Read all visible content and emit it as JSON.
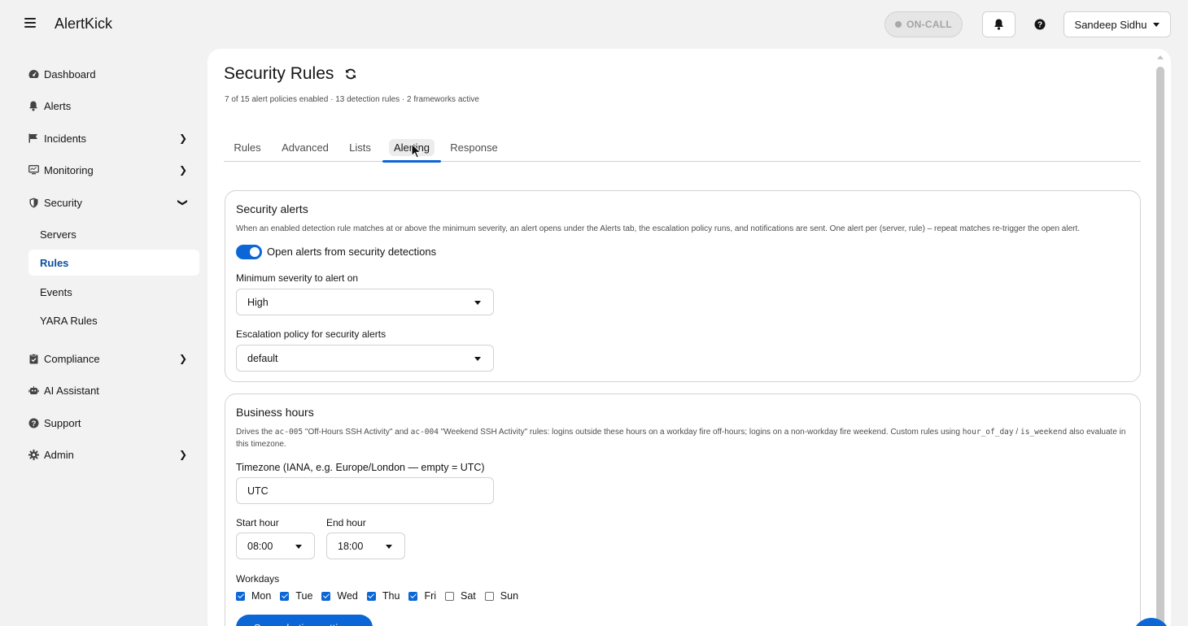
{
  "app": {
    "name": "AlertKick"
  },
  "header": {
    "oncall_label": "ON-CALL",
    "user_name": "Sandeep Sidhu"
  },
  "sidebar": {
    "items": [
      {
        "label": "Dashboard",
        "icon": "dashboard-icon"
      },
      {
        "label": "Alerts",
        "icon": "bell-icon"
      },
      {
        "label": "Incidents",
        "icon": "flag-icon"
      },
      {
        "label": "Monitoring",
        "icon": "monitor-icon"
      },
      {
        "label": "Security",
        "icon": "shield-icon"
      },
      {
        "label": "Compliance",
        "icon": "clipboard-icon"
      },
      {
        "label": "AI Assistant",
        "icon": "robot-icon"
      },
      {
        "label": "Support",
        "icon": "help-icon"
      },
      {
        "label": "Admin",
        "icon": "gear-icon"
      }
    ],
    "security_children": [
      {
        "label": "Servers"
      },
      {
        "label": "Rules"
      },
      {
        "label": "Events"
      },
      {
        "label": "YARA Rules"
      }
    ],
    "active": "Rules"
  },
  "page": {
    "title": "Security Rules",
    "subtitle": "7 of 15 alert policies enabled · 13 detection rules · 2 frameworks active"
  },
  "tabs": [
    {
      "label": "Rules"
    },
    {
      "label": "Advanced"
    },
    {
      "label": "Lists"
    },
    {
      "label": "Alerting"
    },
    {
      "label": "Response"
    }
  ],
  "active_tab": "Alerting",
  "security_alerts": {
    "title": "Security alerts",
    "description": "When an enabled detection rule matches at or above the minimum severity, an alert opens under the Alerts tab, the escalation policy runs, and notifications are sent. One alert per (server, rule) – repeat matches re-trigger the open alert.",
    "toggle_label": "Open alerts from security detections",
    "toggle_on": true,
    "severity_label": "Minimum severity to alert on",
    "severity_value": "High",
    "escalation_label": "Escalation policy for security alerts",
    "escalation_value": "default"
  },
  "business_hours": {
    "title": "Business hours",
    "desc": {
      "part1": "Drives the ",
      "code1": "ac-005",
      "part2": " \"Off-Hours SSH Activity\" and ",
      "code2": "ac-004",
      "part3": " \"Weekend SSH Activity\" rules: logins outside these hours on a workday fire off-hours; logins on a non-workday fire weekend. Custom rules using ",
      "code3": "hour_of_day",
      "part4": " / ",
      "code4": "is_weekend",
      "part5": " also evaluate in this timezone."
    },
    "timezone_label": "Timezone (IANA, e.g. Europe/London — empty = UTC)",
    "timezone_value": "UTC",
    "start_label": "Start hour",
    "start_value": "08:00",
    "end_label": "End hour",
    "end_value": "18:00",
    "workdays_label": "Workdays",
    "workdays": [
      {
        "label": "Mon",
        "checked": true
      },
      {
        "label": "Tue",
        "checked": true
      },
      {
        "label": "Wed",
        "checked": true
      },
      {
        "label": "Thu",
        "checked": true
      },
      {
        "label": "Fri",
        "checked": true
      },
      {
        "label": "Sat",
        "checked": false
      },
      {
        "label": "Sun",
        "checked": false
      }
    ],
    "save_label": "Save alerting settings"
  },
  "colors": {
    "accent": "#0b66d6",
    "active_text": "#0b4ea2",
    "background": "#f2f2f2"
  }
}
